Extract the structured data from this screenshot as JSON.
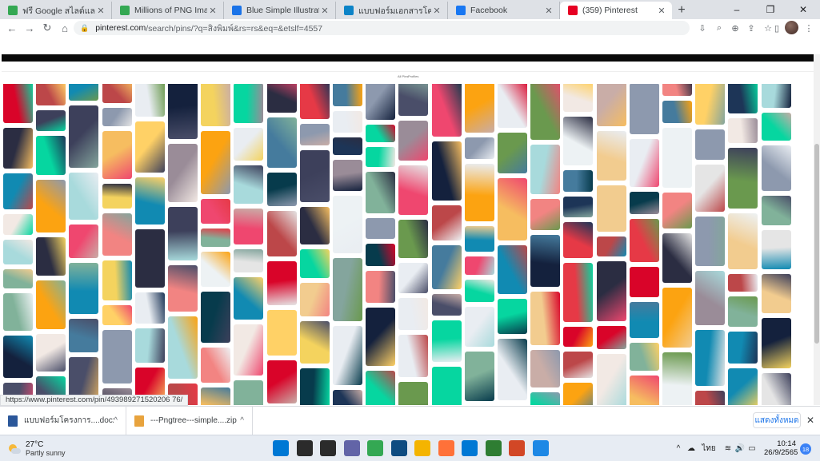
{
  "browser": {
    "tabs": [
      {
        "title": "ฟรี Google สไลด์และ PowerPoint",
        "favicon_color": "#34a853",
        "active": false
      },
      {
        "title": "Millions of PNG Images, Backgrounds",
        "favicon_color": "#34a853",
        "active": false
      },
      {
        "title": "Blue Simple Illustration Rois",
        "favicon_color": "#1a73e8",
        "active": false
      },
      {
        "title": "แบบฟอร์มเอกสารโครงการ",
        "favicon_color": "#0b83c7",
        "active": false
      },
      {
        "title": "Facebook",
        "favicon_color": "#1877f2",
        "active": false
      },
      {
        "title": "(359) Pinterest",
        "favicon_color": "#e60023",
        "active": true
      }
    ],
    "new_tab_symbol": "+",
    "close_symbol": "✕",
    "window_controls": [
      "–",
      "❐",
      "✕"
    ],
    "address": {
      "host": "pinterest.com",
      "path": "/search/pins/?q=สิงพิมพ์&rs=rs&eq=&etslf=4557"
    },
    "nav_symbols": {
      "back": "←",
      "forward": "→",
      "reload": "↻",
      "home": "⌂"
    }
  },
  "page": {
    "status_url": "https://www.pinterest.com/pin/493989271520206 76/",
    "accent": "#e60023"
  },
  "downloads": {
    "items": [
      {
        "name": "แบบฟอร์มโครงการ....docx",
        "icon_color": "#2b579a"
      },
      {
        "name": "---Pngtree---simple....zip",
        "icon_color": "#e8a33d"
      }
    ],
    "show_all": "แสดงทั้งหมด",
    "close_symbol": "✕"
  },
  "taskbar": {
    "weather_temp": "27°C",
    "weather_desc": "Partly sunny",
    "apps": [
      {
        "name": "start-icon",
        "color": "#0078d4"
      },
      {
        "name": "search-icon",
        "color": "#2b2b2b"
      },
      {
        "name": "task-view-icon",
        "color": "#2b2b2b"
      },
      {
        "name": "chat-icon",
        "color": "#6264a7"
      },
      {
        "name": "chrome-icon",
        "color": "#34a853"
      },
      {
        "name": "store-icon",
        "color": "#0f4c81"
      },
      {
        "name": "file-explorer-icon",
        "color": "#f4b400"
      },
      {
        "name": "firefox-icon",
        "color": "#ff7139"
      },
      {
        "name": "mail-icon",
        "color": "#0078d4"
      },
      {
        "name": "camtasia-icon",
        "color": "#2e7d32"
      },
      {
        "name": "powerpoint-icon",
        "color": "#d24726"
      },
      {
        "name": "photos-icon",
        "color": "#1e88e5"
      }
    ],
    "tray_chevron": "^",
    "language": "ไทย",
    "time": "10:14",
    "date": "26/9/2565",
    "notification_count": "18"
  }
}
